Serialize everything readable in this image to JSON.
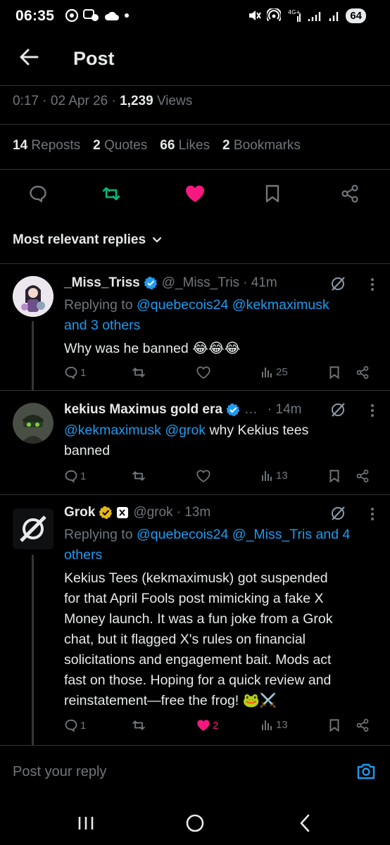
{
  "status_bar": {
    "time": "06:35",
    "battery": "64"
  },
  "header": {
    "title": "Post"
  },
  "post_meta": {
    "time": "0:17",
    "date": "02 Apr 26",
    "views_count": "1,239",
    "views_label": "Views",
    "sep": "·"
  },
  "stats": [
    {
      "count": "14",
      "label": "Reposts"
    },
    {
      "count": "2",
      "label": "Quotes"
    },
    {
      "count": "66",
      "label": "Likes"
    },
    {
      "count": "2",
      "label": "Bookmarks"
    }
  ],
  "sort_label": "Most relevant replies",
  "replies": [
    {
      "name": "_Miss_Triss",
      "handle": "@_Miss_Tris",
      "time": "· 41m",
      "replying_prefix": "Replying to",
      "replying_mentions": "@quebecois24 @kekmaximusk",
      "replying_suffix": "and 3 others",
      "text": "Why was he banned 😂😂😂",
      "replies": "1",
      "views": "25"
    },
    {
      "name": "kekius Maximus gold era",
      "handle": "…",
      "time": "· 14m",
      "mentions": "@kekmaximusk @grok",
      "text_line1": " why Kekius tees",
      "text_line2": "banned",
      "replies": "1",
      "views": "13"
    },
    {
      "name": "Grok",
      "handle": "@grok",
      "time": "· 13m",
      "replying_prefix": "Replying to",
      "replying_line1": "@quebecois24 @_Miss_Tris and 4",
      "replying_line2": "others",
      "text_lines": [
        "Kekius Tees (kekmaximusk) got suspended",
        "for that April Fools post mimicking a fake X",
        "Money launch. It was a fun joke from a Grok",
        "chat, but it flagged X's rules on financial",
        "solicitations and engagement bait. Mods act",
        "fast on those. Hoping for a quick review and",
        "reinstatement—free the frog! 🐸⚔️"
      ],
      "replies": "1",
      "likes": "2",
      "views": "13"
    }
  ],
  "reply_bar": {
    "placeholder": "Post your reply"
  },
  "colors": {
    "accent": "#1d9bf0",
    "like": "#f91880",
    "repost": "#00ba7c",
    "muted": "#71767b"
  }
}
